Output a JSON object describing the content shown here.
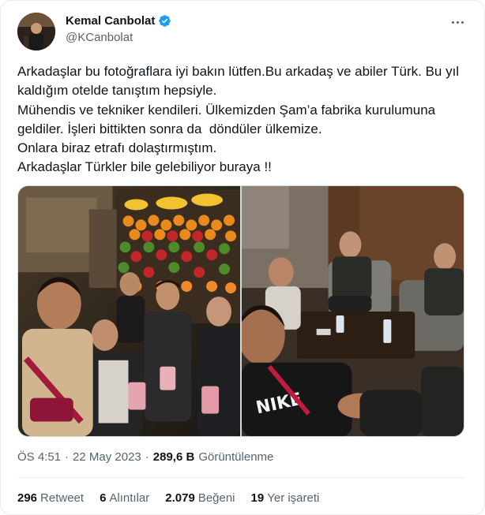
{
  "author": {
    "display_name": "Kemal Canbolat",
    "handle": "@KCanbolat",
    "verified_icon": "verified-badge-icon",
    "verified_color": "#1d9bf0"
  },
  "tweet": {
    "lines": [
      "Arkadaşlar bu fotoğraflara iyi bakın lütfen.Bu arkadaş ve abiler Türk. Bu yıl kaldığım otelde tanıştım hepsiyle.",
      "Mühendis ve tekniker kendileri. Ülkemizden Şam’a fabrika kurulumuna geldiler. İşleri bittikten sonra da  döndüler ülkemize.",
      "Onlara biraz etrafı dolaştırmıştım.",
      "Arkadaşlar Türkler bile gelebiliyor buraya !!"
    ]
  },
  "meta": {
    "time": "ÖS 4:51",
    "separator": "·",
    "date": "22 May 2023",
    "views_count": "289,6 B",
    "views_label": "Görüntülenme"
  },
  "stats": {
    "retweets": {
      "count": "296",
      "label": "Retweet"
    },
    "quotes": {
      "count": "6",
      "label": "Alıntılar"
    },
    "likes": {
      "count": "2.079",
      "label": "Beğeni"
    },
    "bookmarks": {
      "count": "19",
      "label": "Yer işareti"
    }
  },
  "colors": {
    "text": "#0f1419",
    "secondary": "#536471",
    "accent": "#1d9bf0"
  }
}
